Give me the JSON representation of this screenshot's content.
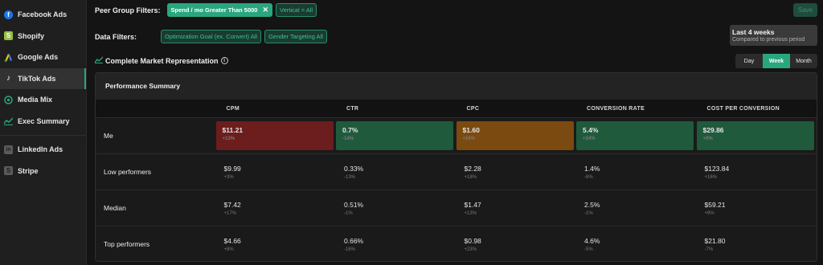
{
  "sidebar": {
    "items": [
      {
        "label": "Facebook Ads",
        "icon": "facebook-icon",
        "color": "#1877f2"
      },
      {
        "label": "Shopify",
        "icon": "shopify-icon",
        "color": "#95bf47"
      },
      {
        "label": "Google Ads",
        "icon": "google-ads-icon",
        "color": "#4285f4"
      },
      {
        "label": "TikTok Ads",
        "icon": "tiktok-icon",
        "color": "#ffffff",
        "active": true
      },
      {
        "label": "Media Mix",
        "icon": "media-mix-icon",
        "color": "#2aa67f"
      },
      {
        "label": "Exec Summary",
        "icon": "exec-summary-icon",
        "color": "#2aa67f"
      }
    ],
    "items2": [
      {
        "label": "LinkedIn Ads",
        "icon": "linkedin-icon",
        "color": "#8a8a8a"
      },
      {
        "label": "Stripe",
        "icon": "stripe-icon",
        "color": "#8a8a8a"
      }
    ]
  },
  "filters": {
    "peer_label": "Peer Group Filters:",
    "peer_chips": [
      "Spend / mo Greater Than 5000",
      "Vertical = All"
    ],
    "data_label": "Data Filters:",
    "data_chips": [
      "Optimization Goal (ex. Convert) All",
      "Gender Targeting All"
    ]
  },
  "save_label": "Save",
  "date": {
    "title": "Last 4 weeks",
    "subtitle": "Compared to previous period"
  },
  "market_title": "Complete Market Representation",
  "toggle": [
    "Day",
    "Week",
    "Month"
  ],
  "summary": {
    "title": "Performance Summary",
    "columns": [
      "CPM",
      "CTR",
      "CPC",
      "CONVERSION RATE",
      "COST PER CONVERSION"
    ],
    "me": {
      "label": "Me",
      "cells": [
        {
          "value": "$11.21",
          "delta": "+13%",
          "tone": "red"
        },
        {
          "value": "0.7%",
          "delta": "-14%",
          "tone": "green"
        },
        {
          "value": "$1.60",
          "delta": "+24%",
          "tone": "orange"
        },
        {
          "value": "5.4%",
          "delta": "+24%",
          "tone": "green"
        },
        {
          "value": "$29.86",
          "delta": "+0%",
          "tone": "green"
        }
      ]
    },
    "rows": [
      {
        "label": "Low performers",
        "cells": [
          {
            "value": "$9.99",
            "delta": "+3%"
          },
          {
            "value": "0.33%",
            "delta": "-13%"
          },
          {
            "value": "$2.28",
            "delta": "+18%"
          },
          {
            "value": "1.4%",
            "delta": "-6%"
          },
          {
            "value": "$123.84",
            "delta": "+16%"
          }
        ]
      },
      {
        "label": "Median",
        "cells": [
          {
            "value": "$7.42",
            "delta": "+17%"
          },
          {
            "value": "0.51%",
            "delta": "-1%"
          },
          {
            "value": "$1.47",
            "delta": "+13%"
          },
          {
            "value": "2.5%",
            "delta": "-1%"
          },
          {
            "value": "$59.21",
            "delta": "+9%"
          }
        ]
      },
      {
        "label": "Top performers",
        "cells": [
          {
            "value": "$4.66",
            "delta": "+8%"
          },
          {
            "value": "0.66%",
            "delta": "-16%"
          },
          {
            "value": "$0.98",
            "delta": "+23%"
          },
          {
            "value": "4.6%",
            "delta": "-5%"
          },
          {
            "value": "$21.80",
            "delta": "-7%"
          }
        ]
      }
    ]
  }
}
